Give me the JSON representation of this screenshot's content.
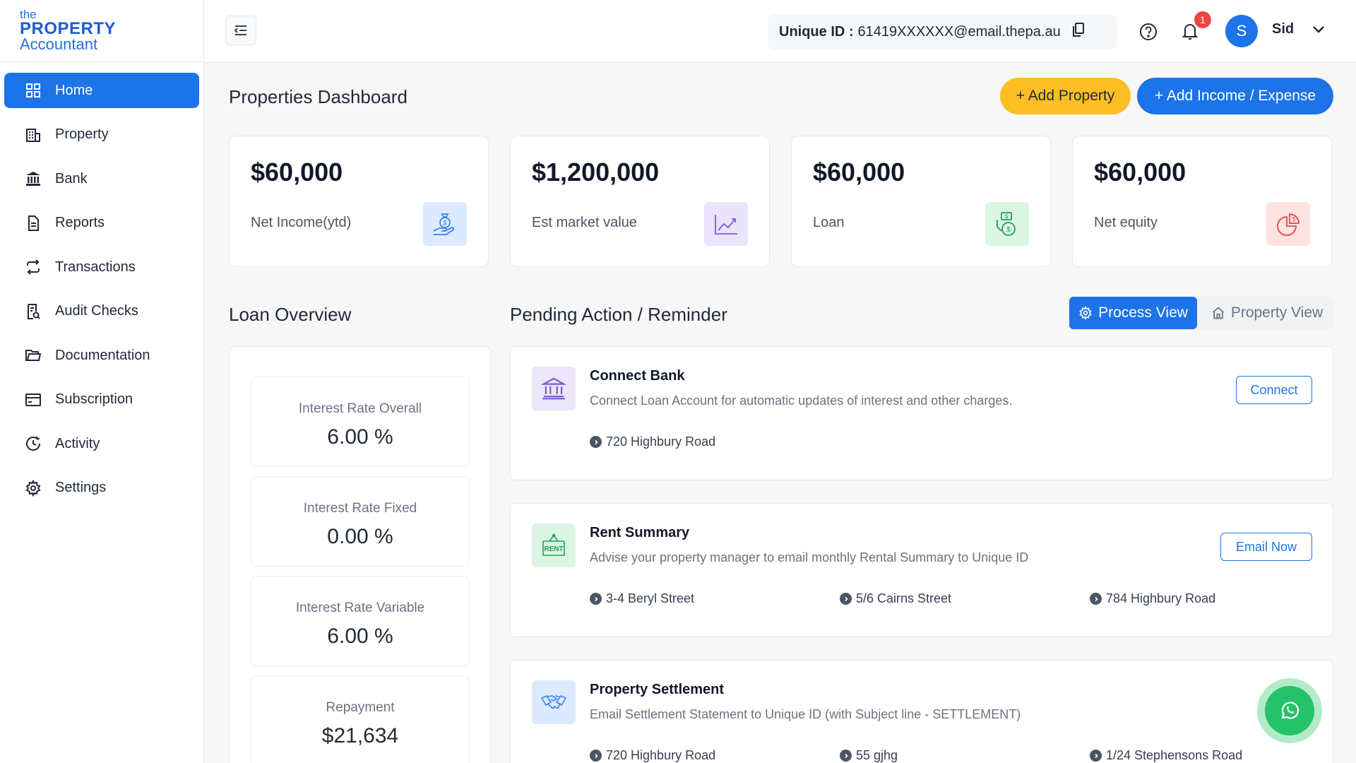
{
  "logo": {
    "line1": "the",
    "line2": "PROPERTY",
    "line3": "Accountant"
  },
  "sidebar": {
    "items": [
      {
        "label": "Home",
        "icon": "grid-icon",
        "active": true
      },
      {
        "label": "Property",
        "icon": "building-icon"
      },
      {
        "label": "Bank",
        "icon": "bank-icon"
      },
      {
        "label": "Reports",
        "icon": "document-icon"
      },
      {
        "label": "Transactions",
        "icon": "exchange-icon"
      },
      {
        "label": "Audit Checks",
        "icon": "audit-icon"
      },
      {
        "label": "Documentation",
        "icon": "folder-icon"
      },
      {
        "label": "Subscription",
        "icon": "card-icon"
      },
      {
        "label": "Activity",
        "icon": "clock-icon"
      },
      {
        "label": "Settings",
        "icon": "gear-icon"
      }
    ]
  },
  "header": {
    "unique_id_label": "Unique ID :",
    "unique_id_value": "61419XXXXXX@email.thepa.au",
    "notification_count": "1",
    "avatar_initial": "S",
    "username": "Sid"
  },
  "page": {
    "title": "Properties Dashboard",
    "add_property": "+ Add Property",
    "add_income_expense": "+ Add Income / Expense"
  },
  "stats": [
    {
      "value": "$60,000",
      "label": "Net Income(ytd)",
      "icon": "money-hand-icon",
      "color": "#dbeafe"
    },
    {
      "value": "$1,200,000",
      "label": "Est market value",
      "icon": "trend-chart-icon",
      "color": "#e9e3fc"
    },
    {
      "value": "$60,000",
      "label": "Loan",
      "icon": "money-bag-icon",
      "color": "#dcf5e3"
    },
    {
      "value": "$60,000",
      "label": "Net equity",
      "icon": "pie-chart-icon",
      "color": "#fde2e2"
    }
  ],
  "loan_overview": {
    "title": "Loan Overview",
    "items": [
      {
        "label": "Interest Rate Overall",
        "value": "6.00 %"
      },
      {
        "label": "Interest Rate Fixed",
        "value": "0.00 %"
      },
      {
        "label": "Interest Rate Variable",
        "value": "6.00 %"
      },
      {
        "label": "Repayment",
        "value": "$21,634"
      }
    ]
  },
  "pending": {
    "title": "Pending Action / Reminder",
    "process_view": "Process View",
    "property_view": "Property View",
    "actions": [
      {
        "title": "Connect Bank",
        "description": "Connect Loan Account for automatic updates of interest and other charges.",
        "button": "Connect",
        "icon": "bank-icon",
        "addresses": [
          "720 Highbury Road"
        ]
      },
      {
        "title": "Rent Summary",
        "description": "Advise your property manager to email monthly Rental Summary to Unique ID",
        "button": "Email Now",
        "icon": "rent-sign-icon",
        "addresses": [
          "3-4 Beryl Street",
          "5/6 Cairns Street",
          "784 Highbury Road"
        ]
      },
      {
        "title": "Property Settlement",
        "description": "Email Settlement Statement to Unique ID (with Subject line - SETTLEMENT)",
        "icon": "handshake-icon",
        "addresses": [
          "720 Highbury Road",
          "55 gjhg",
          "1/24 Stephensons Road"
        ]
      }
    ]
  },
  "colors": {
    "primary": "#1d73e8",
    "accent": "#fbbf24",
    "whatsapp": "#25c26a"
  }
}
